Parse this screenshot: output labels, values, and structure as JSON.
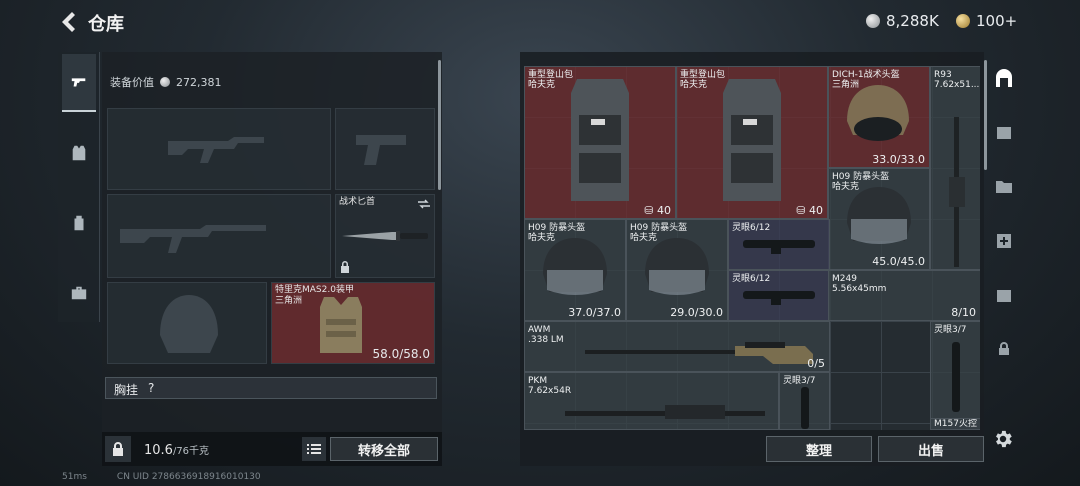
{
  "header": {
    "title": "仓库",
    "back_icon": "back-arrow-icon"
  },
  "currency": [
    {
      "icon": "coin-icon",
      "value": "8,288K"
    },
    {
      "icon": "gold-coin-icon",
      "value": "100+"
    }
  ],
  "left_rail": [
    "pistol-icon",
    "armor-vest-icon",
    "backpack-icon",
    "briefcase-icon"
  ],
  "loadout": {
    "equip_value_label": "装备价值",
    "equip_value": "272,381",
    "knife_label": "战术匕首",
    "armor_name": "特里克MAS2.0装甲",
    "armor_brand": "三角洲",
    "armor_durability": "58.0/58.0",
    "chest_rig_label": "胸挂",
    "chest_rig_help": "?"
  },
  "bottom_left": {
    "weight": "10.6",
    "weight_max": "/76千克",
    "transfer_all": "转移全部"
  },
  "storage_items": [
    {
      "name": "重型登山包\n哈夫克",
      "count": "40"
    },
    {
      "name": "重型登山包\n哈夫克",
      "count": "40"
    },
    {
      "name": "DICH-1战术头盔\n三角洲",
      "durability": "33.0/33.0"
    },
    {
      "name": "R93\n7.62x51..."
    },
    {
      "name": "H09 防暴头盔\n哈夫克",
      "durability": "45.0/45.0"
    },
    {
      "name": "H09 防暴头盔\n哈夫克",
      "durability": "37.0/37.0"
    },
    {
      "name": "H09 防暴头盔\n哈夫克",
      "durability": "29.0/30.0"
    },
    {
      "name": "灵眼6/12"
    },
    {
      "name": "灵眼6/12"
    },
    {
      "name": "M249\n5.56x45mm",
      "count": "8/10"
    },
    {
      "name": "AWM\n.338 LM",
      "count": "0/5"
    },
    {
      "name": "灵眼3/7"
    },
    {
      "name": "PKM\n7.62x54R"
    },
    {
      "name": "灵眼3/7"
    },
    {
      "name": "M157火控"
    }
  ],
  "actions": {
    "sort": "整理",
    "sell": "出售"
  },
  "status": {
    "ping": "51ms",
    "uid": "CN UID 2786636918916010130"
  }
}
